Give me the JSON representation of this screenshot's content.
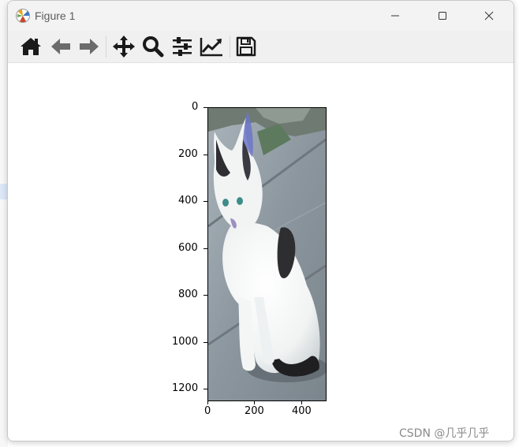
{
  "window": {
    "title": "Figure 1",
    "controls": [
      "minimize",
      "maximize",
      "close"
    ]
  },
  "toolbar": {
    "buttons": [
      {
        "name": "home",
        "icon": "home-icon"
      },
      {
        "name": "back",
        "icon": "arrow-left-icon"
      },
      {
        "name": "forward",
        "icon": "arrow-right-icon"
      },
      {
        "name": "pan",
        "icon": "move-icon"
      },
      {
        "name": "zoom",
        "icon": "magnifier-icon"
      },
      {
        "name": "configure-subplots",
        "icon": "sliders-icon"
      },
      {
        "name": "edit-axes",
        "icon": "line-chart-icon"
      },
      {
        "name": "save",
        "icon": "floppy-disk-icon"
      }
    ]
  },
  "plot": {
    "y_tick_labels": [
      "0",
      "200",
      "400",
      "600",
      "800",
      "1000",
      "1200"
    ],
    "x_tick_labels": [
      "0",
      "200",
      "400"
    ],
    "image_subject": "white and black kitten sitting on grey pavement"
  },
  "watermark": "CSDN @几乎几乎",
  "colors": {
    "titlebar": "#f3f3f3",
    "toolbar": "#f0f0f0",
    "icon": "#1a1a1a",
    "icon_disabled": "#6b6b6b"
  }
}
